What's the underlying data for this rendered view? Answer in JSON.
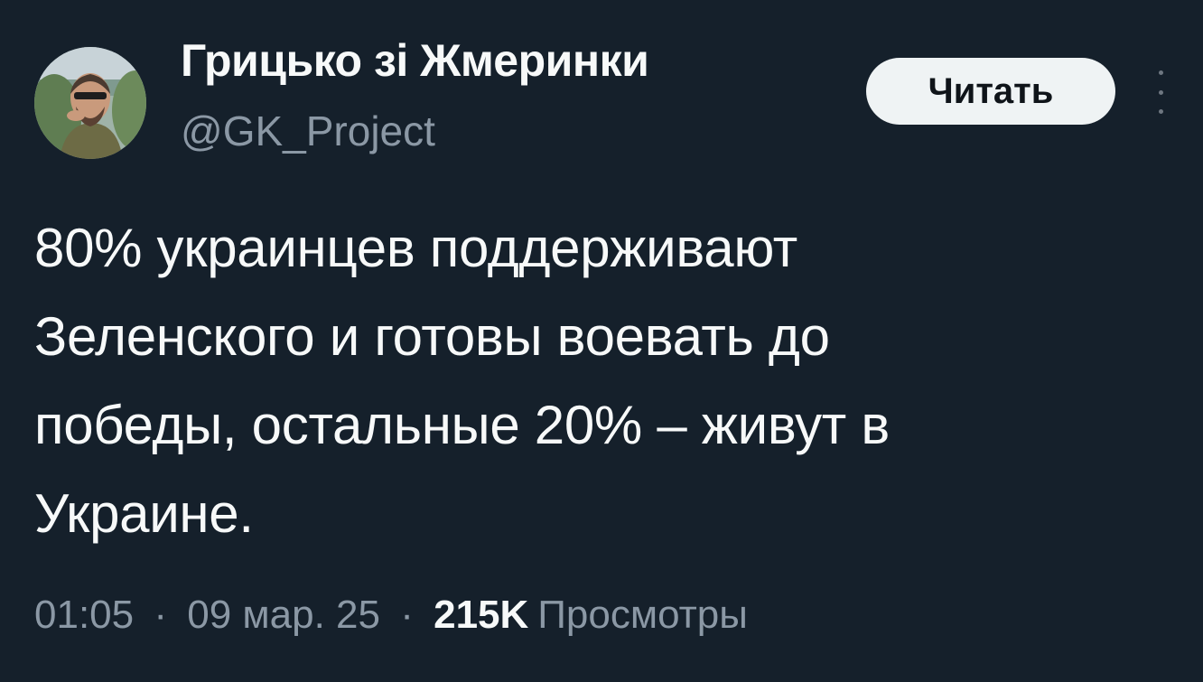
{
  "author": {
    "display_name": "Грицько зі Жмеринки",
    "handle": "@GK_Project",
    "avatar_icon": "user-photo-avatar"
  },
  "follow_button": {
    "label": "Читать"
  },
  "more_button": {
    "icon": "vertical-ellipsis-icon"
  },
  "tweet": {
    "lines": [
      "80% украинцев поддерживают",
      "Зеленского и готовы воевать до",
      "победы, остальные 20% – живут в",
      "Украине."
    ]
  },
  "meta": {
    "time": "01:05",
    "separator": "·",
    "date": "09 мар. 25",
    "views_count": "215K",
    "views_label": "Просмотры"
  },
  "colors": {
    "background": "#15202b",
    "text_primary": "#f7f9f9",
    "text_secondary": "#8b98a5",
    "button_bg": "#eff3f4",
    "button_text": "#0f1419"
  }
}
